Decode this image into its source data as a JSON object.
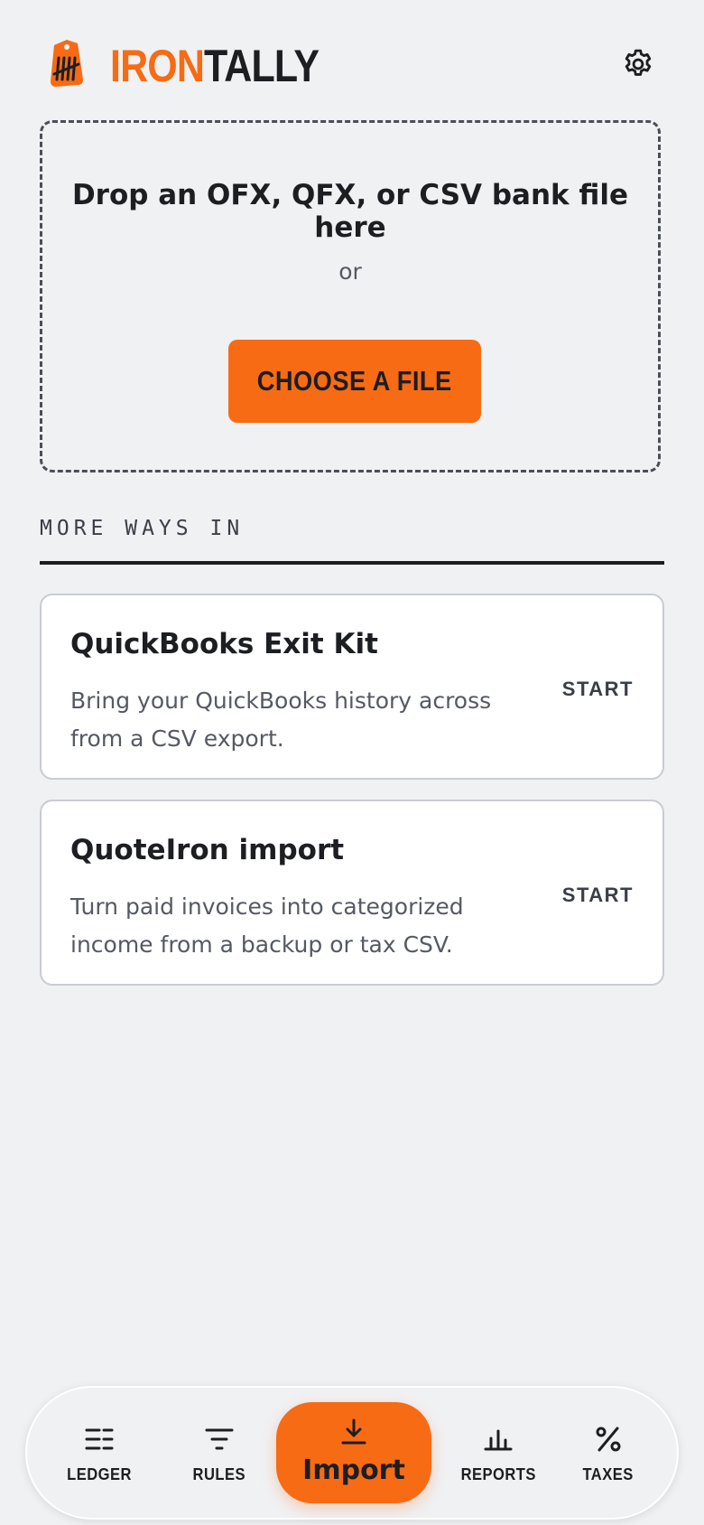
{
  "app": {
    "brand_part1": "IRON",
    "brand_part2": "TALLY",
    "accent_color": "#f76b15",
    "settings_icon": "gear-icon"
  },
  "dropzone": {
    "title": "Drop an OFX, QFX, or CSV bank file here",
    "or_text": "or",
    "button_label": "CHOOSE A FILE"
  },
  "more_ways": {
    "heading": "MORE WAYS IN",
    "cards": [
      {
        "title": "QuickBooks Exit Kit",
        "description": "Bring your QuickBooks history across from a CSV export.",
        "action": "START"
      },
      {
        "title": "QuoteIron import",
        "description": "Turn paid invoices into categorized income from a backup or tax CSV.",
        "action": "START"
      }
    ]
  },
  "nav": {
    "items": [
      {
        "label": "LEDGER",
        "icon": "ledger-list-icon"
      },
      {
        "label": "RULES",
        "icon": "filter-icon"
      },
      {
        "label": "Import",
        "icon": "download-icon",
        "active": true
      },
      {
        "label": "REPORTS",
        "icon": "bar-chart-icon"
      },
      {
        "label": "TAXES",
        "icon": "percent-icon"
      }
    ]
  }
}
